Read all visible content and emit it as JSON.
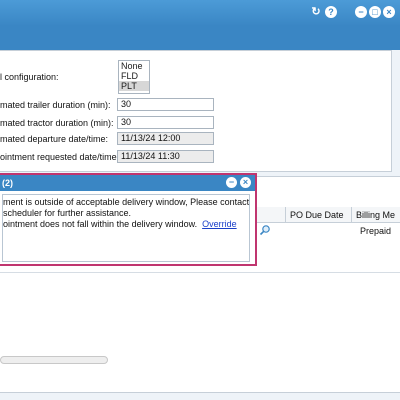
{
  "window": {
    "icons": [
      "refresh-icon",
      "help-icon",
      "minimize-icon",
      "restore-icon",
      "close-icon"
    ]
  },
  "form": {
    "config_label": "l configuration:",
    "config_options": [
      "None",
      "FLD",
      "PLT"
    ],
    "config_selected": "PLT",
    "trailer_label": "mated trailer duration (min):",
    "trailer_value": "30",
    "tractor_label": "mated tractor duration (min):",
    "tractor_value": "30",
    "departure_label": "mated departure date/time:",
    "departure_value": "11/13/24 12:00",
    "appt_label": "ointment requested date/time:",
    "appt_value": "11/13/24 11:30"
  },
  "popup": {
    "title": "(2)",
    "line1": "ment is outside of acceptable delivery window, Please contact",
    "line2": " scheduler for further assistance.",
    "line3": "ointment does not fall within the delivery window.",
    "link": "Override"
  },
  "grid": {
    "columns": [
      "PO Due Date",
      "Billing Me"
    ],
    "rows": [
      {
        "po_due_date": "",
        "billing": "Prepaid"
      }
    ]
  },
  "colors": {
    "accent": "#3a86c4",
    "alert_border": "#c0356f",
    "link": "#1a3fc9"
  }
}
